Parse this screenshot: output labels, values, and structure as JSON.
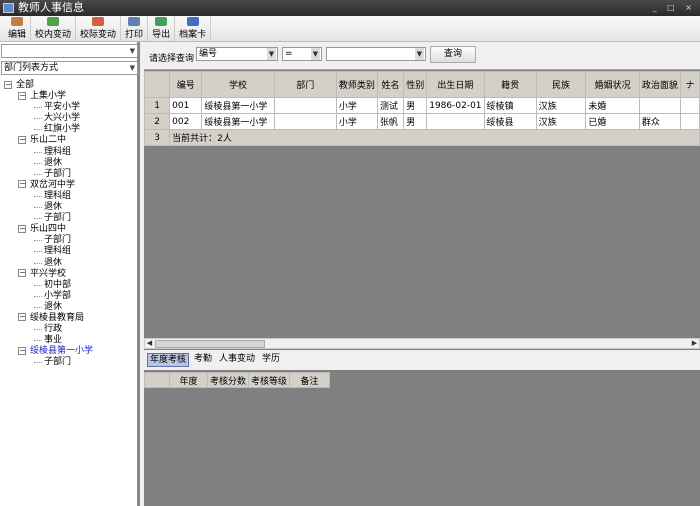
{
  "window": {
    "title": "教师人事信息"
  },
  "toolbar": [
    {
      "label": "编辑",
      "icon": "edit-icon",
      "color": "#c08040"
    },
    {
      "label": "校内变动",
      "icon": "users-icon",
      "color": "#50a050"
    },
    {
      "label": "校际变动",
      "icon": "users-transfer-icon",
      "color": "#d06040"
    },
    {
      "label": "打印",
      "icon": "printer-icon",
      "color": "#6080b0"
    },
    {
      "label": "导出",
      "icon": "export-icon",
      "color": "#40a060"
    },
    {
      "label": "档案卡",
      "icon": "archive-card-icon",
      "color": "#4070c0"
    }
  ],
  "left": {
    "combo1": "",
    "combo2": "部门列表方式",
    "tree": {
      "root": "全部",
      "groups": [
        {
          "label": "上集小学",
          "children": [
            "平安小学",
            "大兴小学",
            "红旗小学"
          ]
        },
        {
          "label": "乐山二中",
          "children": [
            "理科组",
            "退休",
            "子部门"
          ]
        },
        {
          "label": "双岔河中学",
          "children": [
            "理科组",
            "退休",
            "子部门"
          ]
        },
        {
          "label": "乐山四中",
          "children": [
            "子部门",
            "理科组",
            "退休"
          ]
        },
        {
          "label": "平兴学校",
          "children": [
            "初中部",
            "小学部",
            "退休"
          ]
        },
        {
          "label": "绥棱县教育局",
          "children": [
            "行政",
            "事业"
          ]
        },
        {
          "label": "绥棱县第一小学",
          "children": [
            "子部门"
          ],
          "selected": true
        }
      ]
    }
  },
  "query": {
    "label": "请选择查询",
    "field": "编号",
    "op": "=",
    "value": "",
    "button": "查询"
  },
  "grid": {
    "columns": [
      "编号",
      "学校",
      "部门",
      "教师类别",
      "姓名",
      "性别",
      "出生日期",
      "籍贯",
      "民族",
      "婚姻状况",
      "政治面貌",
      "ナ"
    ],
    "rows": [
      [
        "1",
        "001",
        "绥棱县第一小学",
        "",
        "小学",
        "测试",
        "男",
        "1986-02-01",
        "绥棱镇",
        "汉族",
        "未婚",
        "",
        ""
      ],
      [
        "2",
        "002",
        "绥棱县第一小学",
        "",
        "小学",
        "张帆",
        "男",
        "",
        "绥棱县",
        "汉族",
        "已婚",
        "群众",
        ""
      ]
    ],
    "total_row_num": "3",
    "total": "当前共计：2人"
  },
  "tabs": [
    "年度考核",
    "考勤",
    "人事变动",
    "学历"
  ],
  "subgrid": {
    "columns": [
      "年度",
      "考核分数",
      "考核等级",
      "备注"
    ]
  }
}
